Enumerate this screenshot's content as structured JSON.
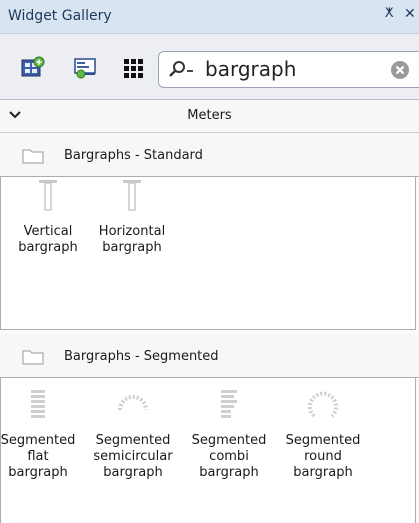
{
  "window": {
    "title": "Widget Gallery",
    "pin_glyph": "ⵅ",
    "close_glyph": "✕"
  },
  "toolbar": {
    "buttons": [
      {
        "icon": "add-widget-icon"
      },
      {
        "icon": "widget-properties-icon"
      },
      {
        "icon": "grid-view-icon"
      }
    ],
    "search": {
      "icon": "search-dropdown-icon",
      "value": "bargraph",
      "clear_icon": "clear-search-icon"
    }
  },
  "category": {
    "label": "Meters",
    "expanded": true
  },
  "groups": [
    {
      "label": "Bargraphs - Standard",
      "items": [
        {
          "label": "Vertical\nbargraph",
          "icon": "vertical-bargraph-icon"
        },
        {
          "label": "Horizontal\nbargraph",
          "icon": "horizontal-bargraph-icon"
        }
      ]
    },
    {
      "label": "Bargraphs - Segmented",
      "items": [
        {
          "label": "Segmented\nflat\nbargraph",
          "icon": "segmented-flat-bargraph-icon"
        },
        {
          "label": "Segmented\nsemicircular\nbargraph",
          "icon": "segmented-semicircular-bargraph-icon"
        },
        {
          "label": "Segmented\ncombi\nbargraph",
          "icon": "segmented-combi-bargraph-icon"
        },
        {
          "label": "Segmented\nround\nbargraph",
          "icon": "segmented-round-bargraph-icon"
        }
      ]
    }
  ],
  "colors": {
    "titlebar": "#d9e4f2",
    "title_text": "#1e395b",
    "icon_grey": "#c8c8c8"
  }
}
